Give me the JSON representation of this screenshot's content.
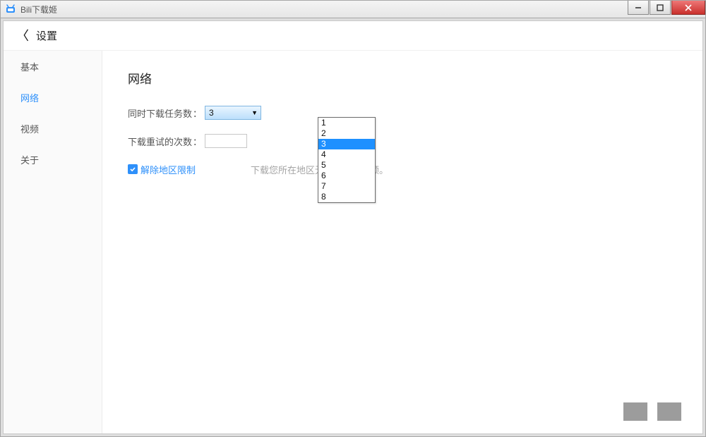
{
  "window": {
    "title": "Bili下载姬"
  },
  "header": {
    "title": "设置"
  },
  "sidebar": {
    "items": [
      {
        "label": "基本",
        "active": false
      },
      {
        "label": "网络",
        "active": true
      },
      {
        "label": "视频",
        "active": false
      },
      {
        "label": "关于",
        "active": false
      }
    ]
  },
  "content": {
    "section_title": "网络",
    "row1": {
      "label": "同时下载任务数",
      "value": "3"
    },
    "row2": {
      "label": "下载重试的次数"
    },
    "checkbox": {
      "label": "解除地区限制",
      "checked": true,
      "hint": "下载您所在地区无法观看的视频。"
    },
    "dropdown_options": [
      "1",
      "2",
      "3",
      "4",
      "5",
      "6",
      "7",
      "8"
    ],
    "dropdown_selected": "3",
    "colon": "："
  }
}
